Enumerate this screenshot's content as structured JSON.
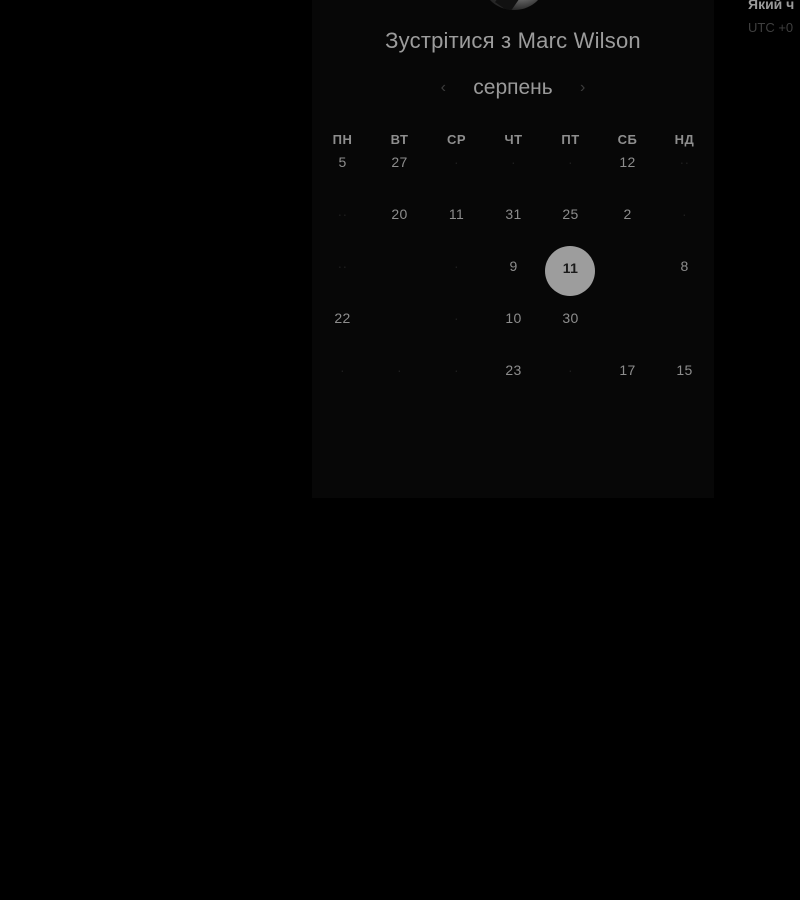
{
  "meeting": {
    "title": "Зустрітися з Marc Wilson"
  },
  "calendar": {
    "month": "серпень",
    "prev_icon": "‹",
    "next_icon": "›",
    "weekdays": [
      "ПН",
      "ВТ",
      "СР",
      "ЧТ",
      "ПТ",
      "СБ",
      "НД"
    ],
    "weeks": [
      [
        {
          "d": "5",
          "dim": false
        },
        {
          "d": "27",
          "dim": false
        },
        {
          "d": "·",
          "dim": true
        },
        {
          "d": "·",
          "dim": true
        },
        {
          "d": "·",
          "dim": true
        },
        {
          "d": "12",
          "dim": false
        },
        {
          "d": "··",
          "dim": true
        }
      ],
      [
        {
          "d": "··",
          "dim": true
        },
        {
          "d": "20",
          "dim": false
        },
        {
          "d": "11",
          "dim": false
        },
        {
          "d": "31",
          "dim": false
        },
        {
          "d": "25",
          "dim": false
        },
        {
          "d": "2",
          "dim": false
        },
        {
          "d": "·",
          "dim": true
        }
      ],
      [
        {
          "d": "··",
          "dim": true
        },
        {
          "d": "",
          "dim": true
        },
        {
          "d": "·",
          "dim": true
        },
        {
          "d": "9",
          "dim": false
        },
        {
          "d": "11",
          "dim": false,
          "selected": true
        },
        {
          "d": "",
          "dim": true
        },
        {
          "d": "8",
          "dim": false
        }
      ],
      [
        {
          "d": "22",
          "dim": false
        },
        {
          "d": "",
          "dim": true
        },
        {
          "d": "·",
          "dim": true
        },
        {
          "d": "10",
          "dim": false
        },
        {
          "d": "30",
          "dim": false
        },
        {
          "d": "",
          "dim": true
        },
        {
          "d": "",
          "dim": true
        }
      ],
      [
        {
          "d": "·",
          "dim": true
        },
        {
          "d": "·",
          "dim": true
        },
        {
          "d": "·",
          "dim": true
        },
        {
          "d": "23",
          "dim": false
        },
        {
          "d": "·",
          "dim": true
        },
        {
          "d": "17",
          "dim": false
        },
        {
          "d": "15",
          "dim": false
        }
      ]
    ]
  },
  "side_panel": {
    "title": "Який ч",
    "timezone": "UTC +0"
  }
}
